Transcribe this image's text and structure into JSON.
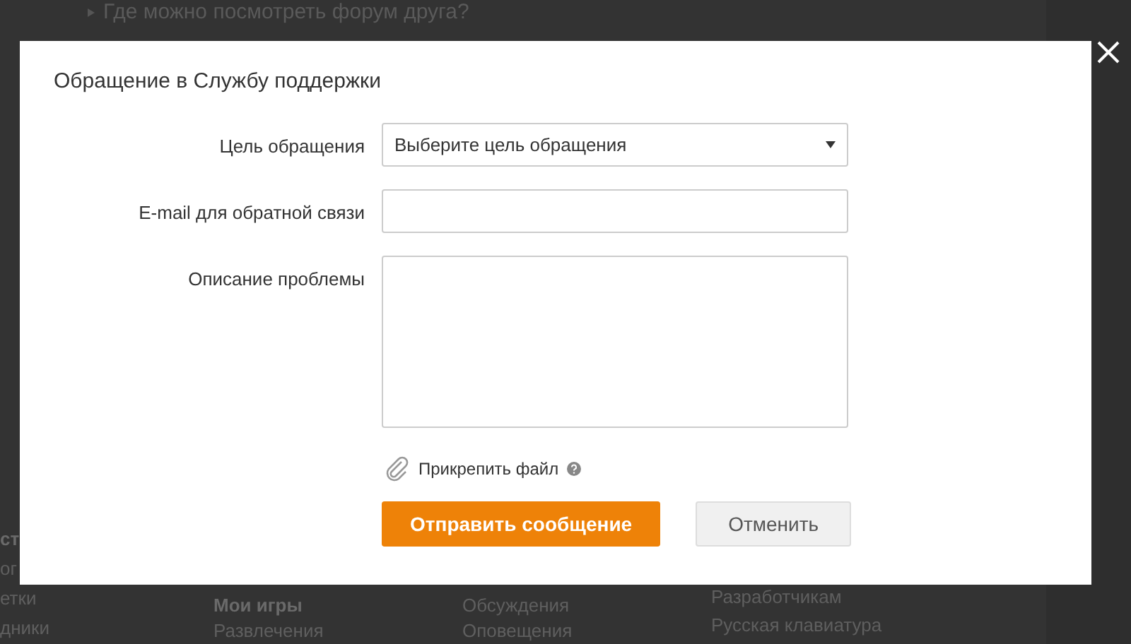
{
  "background_page": {
    "top_item": "Где можно посмотреть форум друга?",
    "footer_columns": [
      {
        "items": [
          {
            "text": "ст",
            "bold": true
          },
          {
            "text": "ог",
            "bold": false
          },
          {
            "text": "етки",
            "bold": false
          },
          {
            "text": "дники",
            "bold": false
          }
        ]
      },
      {
        "items": [
          {
            "text": "Мои игры",
            "bold": true
          },
          {
            "text": "Развлечения",
            "bold": false
          }
        ]
      },
      {
        "items": [
          {
            "text": "Обсуждения",
            "bold": false
          },
          {
            "text": "Оповещения",
            "bold": false
          }
        ]
      },
      {
        "items": [
          {
            "text": "Разработчикам",
            "bold": false
          },
          {
            "text": "Русская клавиатура",
            "bold": false
          }
        ]
      }
    ]
  },
  "dialog": {
    "title": "Обращение в Службу поддержки",
    "fields": [
      {
        "kind": "select",
        "label": "Цель обращения",
        "value": "Выберите цель обращения"
      },
      {
        "kind": "input",
        "label": "E-mail для обратной связи"
      },
      {
        "kind": "textarea",
        "label": "Описание проблемы"
      }
    ],
    "attach_label": "Прикрепить файл",
    "buttons": [
      {
        "label": "Отправить сообщение",
        "primary": true
      },
      {
        "label": "Отменить",
        "primary": false
      }
    ]
  }
}
